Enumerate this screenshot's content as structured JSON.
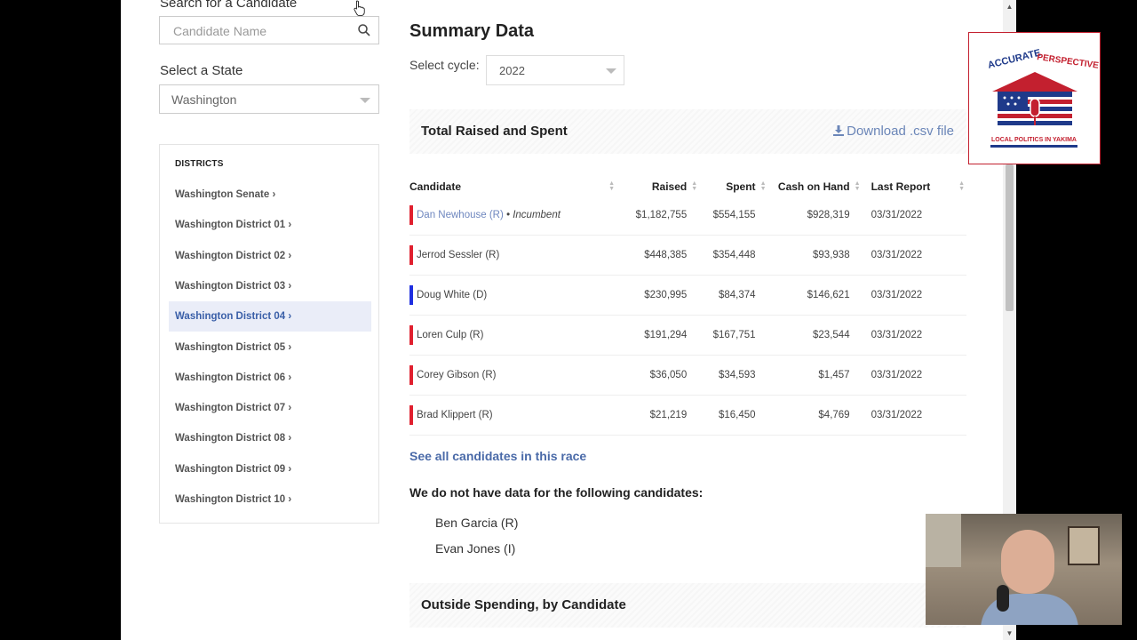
{
  "sidebar": {
    "search_label": "Search for a Candidate",
    "search_placeholder": "Candidate Name",
    "state_label": "Select a State",
    "state_value": "Washington",
    "districts_heading": "DISTRICTS",
    "districts": [
      {
        "label": "Washington Senate ›",
        "active": false
      },
      {
        "label": "Washington District 01 ›",
        "active": false
      },
      {
        "label": "Washington District 02 ›",
        "active": false
      },
      {
        "label": "Washington District 03 ›",
        "active": false
      },
      {
        "label": "Washington District 04 ›",
        "active": true
      },
      {
        "label": "Washington District 05 ›",
        "active": false
      },
      {
        "label": "Washington District 06 ›",
        "active": false
      },
      {
        "label": "Washington District 07 ›",
        "active": false
      },
      {
        "label": "Washington District 08 ›",
        "active": false
      },
      {
        "label": "Washington District 09 ›",
        "active": false
      },
      {
        "label": "Washington District 10 ›",
        "active": false
      }
    ]
  },
  "main": {
    "title": "Summary Data",
    "cycle_label": "Select cycle:",
    "cycle_value": "2022",
    "panel_title": "Total Raised and Spent",
    "download_label": "Download .csv file",
    "columns": [
      "Candidate",
      "Raised",
      "Spent",
      "Cash on Hand",
      "Last Report"
    ],
    "candidates": [
      {
        "name": "Dan Newhouse (R)",
        "incumbent": "• Incumbent",
        "raised": "$1,182,755",
        "spent": "$554,155",
        "cash": "$928,319",
        "last": "03/31/2022",
        "party_color": "#e0202f"
      },
      {
        "name": "Jerrod Sessler (R)",
        "incumbent": "",
        "raised": "$448,385",
        "spent": "$354,448",
        "cash": "$93,938",
        "last": "03/31/2022",
        "party_color": "#e0202f"
      },
      {
        "name": "Doug White (D)",
        "incumbent": "",
        "raised": "$230,995",
        "spent": "$84,374",
        "cash": "$146,621",
        "last": "03/31/2022",
        "party_color": "#1f2fe0"
      },
      {
        "name": "Loren Culp (R)",
        "incumbent": "",
        "raised": "$191,294",
        "spent": "$167,751",
        "cash": "$23,544",
        "last": "03/31/2022",
        "party_color": "#e0202f"
      },
      {
        "name": "Corey Gibson (R)",
        "incumbent": "",
        "raised": "$36,050",
        "spent": "$34,593",
        "cash": "$1,457",
        "last": "03/31/2022",
        "party_color": "#e0202f"
      },
      {
        "name": "Brad Klippert (R)",
        "incumbent": "",
        "raised": "$21,219",
        "spent": "$16,450",
        "cash": "$4,769",
        "last": "03/31/2022",
        "party_color": "#e0202f"
      }
    ],
    "see_all_label": "See all candidates in this race",
    "no_data_heading": "We do not have data for the following candidates:",
    "no_data_candidates": [
      "Ben Garcia (R)",
      "Evan Jones (I)"
    ],
    "outside_spending_title": "Outside Spending, by Candidate"
  },
  "logo": {
    "line1_a": "ACCURATE",
    "line1_b": "PERSPECTIVE",
    "tagline": "LOCAL POLITICS IN YAKIMA"
  }
}
